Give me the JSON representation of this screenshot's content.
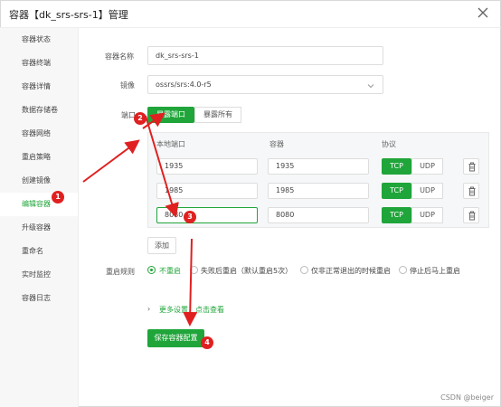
{
  "window": {
    "title": "容器【dk_srs-srs-1】管理"
  },
  "sidebar": {
    "items": [
      {
        "label": "容器状态"
      },
      {
        "label": "容器终端"
      },
      {
        "label": "容器详情"
      },
      {
        "label": "数据存储卷"
      },
      {
        "label": "容器网络"
      },
      {
        "label": "重启策略"
      },
      {
        "label": "创建镜像"
      },
      {
        "label": "编辑容器"
      },
      {
        "label": "升级容器"
      },
      {
        "label": "重命名"
      },
      {
        "label": "实时监控"
      },
      {
        "label": "容器日志"
      }
    ],
    "active_index": 7
  },
  "form": {
    "name_label": "容器名称",
    "name_value": "dk_srs-srs-1",
    "image_label": "镜像",
    "image_value": "ossrs/srs:4.0-r5",
    "port_label": "端口",
    "port_buttons": [
      "暴露端口",
      "暴露所有"
    ],
    "ports_table": {
      "headers": [
        "本地端口",
        "容器",
        "协议"
      ],
      "rows": [
        {
          "local": "1935",
          "container": "1935",
          "protocol": "TCP"
        },
        {
          "local": "1985",
          "container": "1985",
          "protocol": "TCP"
        },
        {
          "local": "8080",
          "container": "8080",
          "protocol": "TCP"
        }
      ],
      "protocol_options": [
        "TCP",
        "UDP"
      ]
    },
    "add_label": "添加",
    "restart_label": "重启规则",
    "restart_options": [
      "不重启",
      "失败后重启（默认重启5次）",
      "仅非正常退出的时候重启",
      "停止后马上重启"
    ],
    "restart_selected": 0,
    "more_settings": "更多设置，点击查看",
    "save_label": "保存容器配置"
  },
  "annotations": {
    "badges": [
      "1",
      "2",
      "3",
      "4"
    ]
  },
  "watermark": "CSDN @beiger",
  "colors": {
    "accent": "#20a53a",
    "annotation": "#e02020"
  }
}
